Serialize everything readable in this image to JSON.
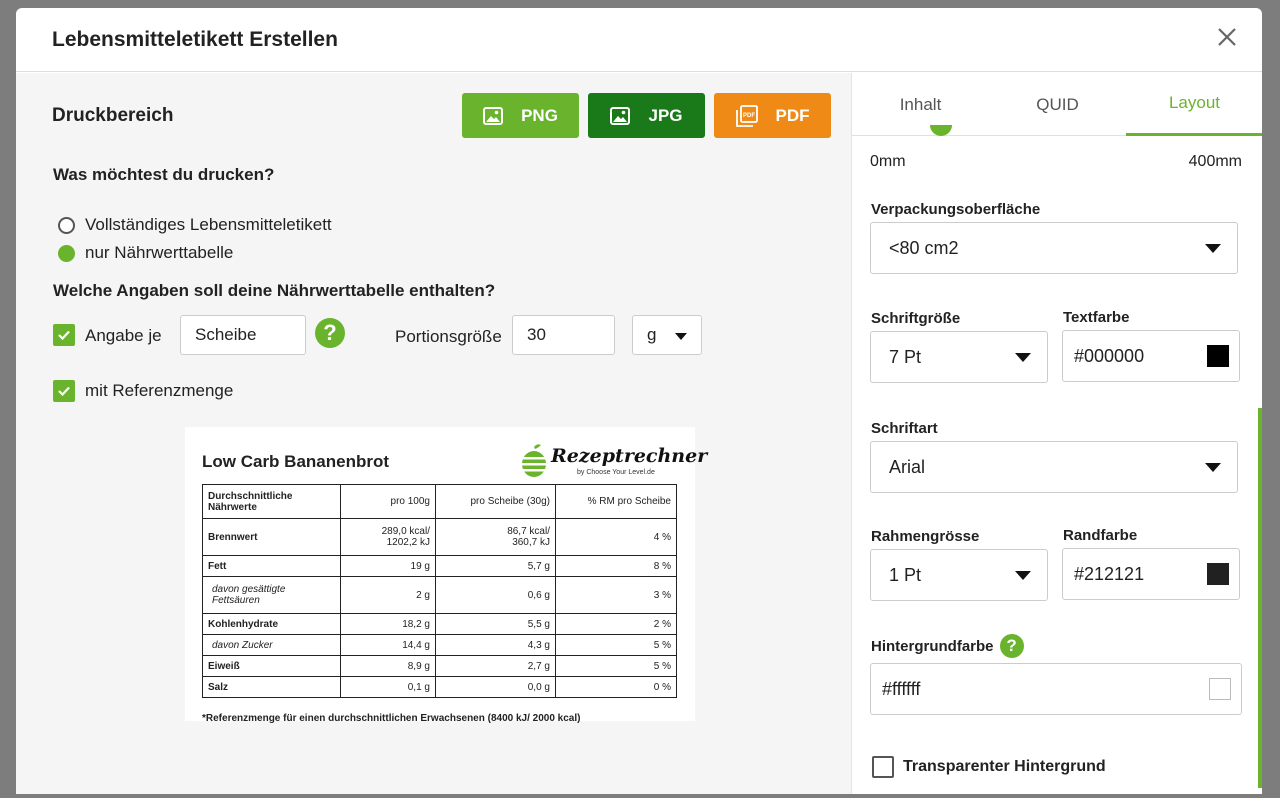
{
  "modal": {
    "title": "Lebensmitteletikett Erstellen"
  },
  "left": {
    "section_title": "Druckbereich",
    "buttons": {
      "png": "PNG",
      "jpg": "JPG",
      "pdf": "PDF"
    },
    "question1": "Was möchtest du drucken?",
    "radio_options": [
      "Vollständiges Lebensmitteletikett",
      "nur Nährwerttabelle"
    ],
    "question2": "Welche Angaben soll deine Nährwerttabelle enthalten?",
    "angabe_je_label": "Angabe je",
    "angabe_je_value": "Scheibe",
    "portion_label": "Portionsgröße",
    "portion_value": "30",
    "portion_unit": "g",
    "referenz_label": "mit Referenzmenge"
  },
  "preview": {
    "title": "Low Carb Bananenbrot",
    "logo_text": "Rezeptrechner",
    "logo_sub": "by Choose Your Level.de",
    "headers": [
      "Durchschnittliche Nährwerte",
      "pro 100g",
      "pro Scheibe (30g)",
      "% RM pro Scheibe"
    ],
    "rows": [
      {
        "name": "Brennwert",
        "v100_1": "289,0 kcal/",
        "v100_2": "1202,2 kJ",
        "vs_1": "86,7 kcal/",
        "vs_2": "360,7 kJ",
        "rm": "4 %"
      },
      {
        "name": "Fett",
        "v100": "19 g",
        "vs": "5,7 g",
        "rm": "8 %"
      },
      {
        "name_1": "davon gesättigte",
        "name_2": "Fettsäuren",
        "v100": "2 g",
        "vs": "0,6 g",
        "rm": "3 %"
      },
      {
        "name": "Kohlenhydrate",
        "v100": "18,2 g",
        "vs": "5,5 g",
        "rm": "2 %"
      },
      {
        "name": "davon Zucker",
        "v100": "14,4 g",
        "vs": "4,3 g",
        "rm": "5 %"
      },
      {
        "name": "Eiweiß",
        "v100": "8,9 g",
        "vs": "2,7 g",
        "rm": "5 %"
      },
      {
        "name": "Salz",
        "v100": "0,1 g",
        "vs": "0,0 g",
        "rm": "0 %"
      }
    ],
    "footnote": "*Referenzmenge für einen durchschnittlichen Erwachsenen (8400 kJ/ 2000 kcal)"
  },
  "right": {
    "tabs": [
      "Inhalt",
      "QUID",
      "Layout"
    ],
    "active_tab": "Layout",
    "range_min": "0mm",
    "range_max": "400mm",
    "verpackung_label": "Verpackungsoberfläche",
    "verpackung_value": "<80 cm2",
    "schriftgroesse_label": "Schriftgröße",
    "schriftgroesse_value": "7 Pt",
    "textfarbe_label": "Textfarbe",
    "textfarbe_value": "#000000",
    "schriftart_label": "Schriftart",
    "schriftart_value": "Arial",
    "rahmen_label": "Rahmengrösse",
    "rahmen_value": "1 Pt",
    "randfarbe_label": "Randfarbe",
    "randfarbe_value": "#212121",
    "hintergrund_label": "Hintergrundfarbe",
    "hintergrund_value": "#ffffff",
    "transparent_label": "Transparenter Hintergrund"
  },
  "colors": {
    "accent": "#6ab42d",
    "jpg": "#1a7a1a",
    "pdf": "#f08a16"
  }
}
